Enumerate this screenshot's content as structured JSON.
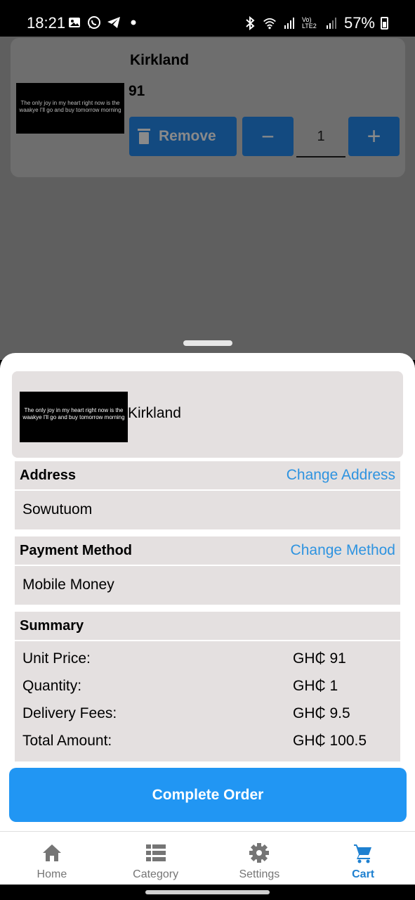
{
  "status_bar": {
    "time": "18:21",
    "battery": "57%",
    "left_icons": [
      "gallery-icon",
      "whatsapp-icon",
      "telegram-icon",
      "dot-icon"
    ],
    "right_icons": [
      "bluetooth-icon",
      "wifi-icon",
      "signal-icon",
      "volte-icon",
      "signal-icon",
      "battery-icon"
    ],
    "volte_label": "Vo) LTE2"
  },
  "background_cart": {
    "product_name": "Kirkland",
    "price": "91",
    "thumb_text": "The only joy in my heart right now is the waakye I'll go and buy tomorrow morning",
    "remove_label": "Remove",
    "minus_label": "−",
    "quantity": "1",
    "plus_label": "+"
  },
  "sheet": {
    "product": {
      "name": "Kirkland",
      "thumb_text": "The only joy in my heart right now is the waakye I'll go and buy tomorrow morning"
    },
    "address": {
      "title": "Address",
      "action": "Change Address",
      "value": "Sowutuom"
    },
    "payment": {
      "title": "Payment Method",
      "action": "Change Method",
      "value": "Mobile Money"
    },
    "summary": {
      "title": "Summary",
      "rows": [
        {
          "label": "Unit Price:",
          "value": "GH₵ 91"
        },
        {
          "label": "Quantity:",
          "value": "GH₵ 1"
        },
        {
          "label": "Delivery Fees:",
          "value": "GH₵ 9.5"
        },
        {
          "label": "Total Amount:",
          "value": "GH₵ 100.5"
        }
      ]
    },
    "complete_button": "Complete Order"
  },
  "bottom_nav": {
    "items": [
      {
        "label": "Home",
        "icon": "home-icon"
      },
      {
        "label": "Category",
        "icon": "list-icon"
      },
      {
        "label": "Settings",
        "icon": "gear-icon"
      },
      {
        "label": "Cart",
        "icon": "cart-icon",
        "active": true
      }
    ]
  },
  "colors": {
    "accent": "#2196f3",
    "link": "#2e93e0",
    "section_bg": "#e4e0e0",
    "active_nav": "#1e80d0"
  }
}
